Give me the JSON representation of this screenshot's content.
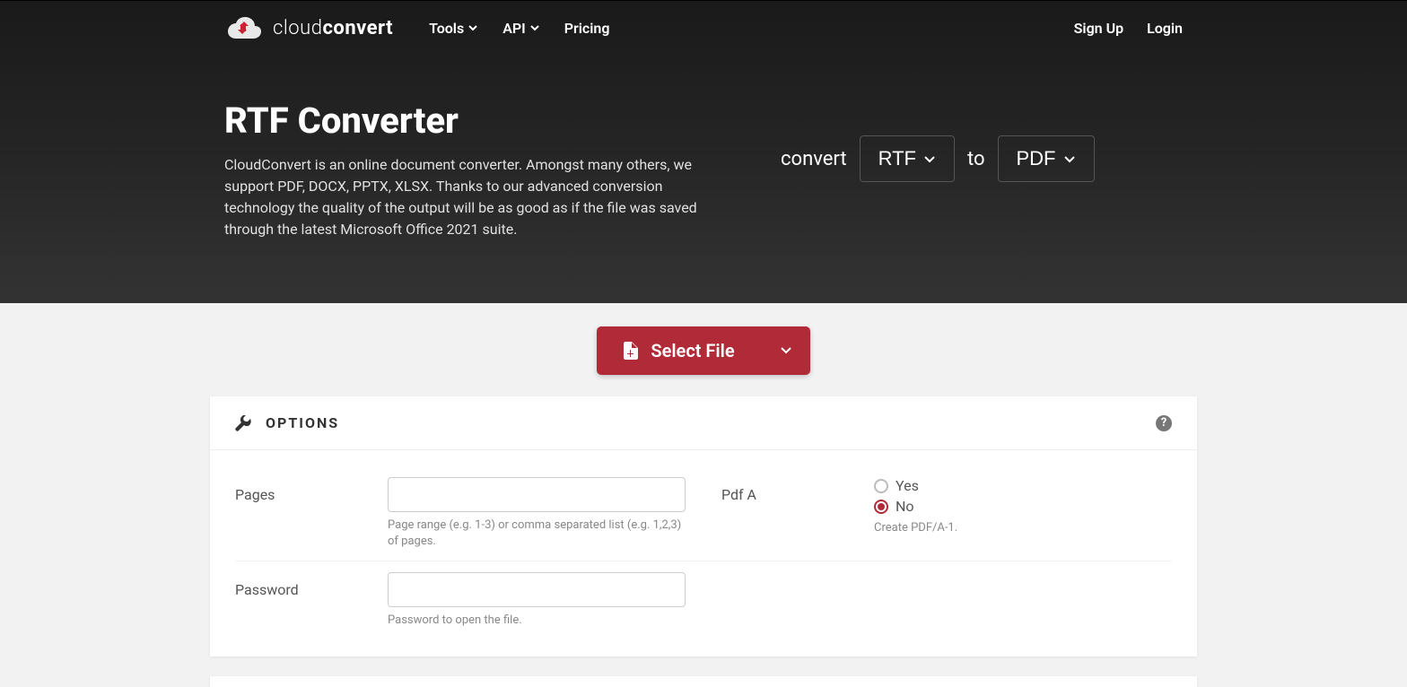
{
  "brand": {
    "part1": "cloud",
    "part2": "convert"
  },
  "nav": {
    "tools": "Tools",
    "api": "API",
    "pricing": "Pricing",
    "signup": "Sign Up",
    "login": "Login"
  },
  "hero": {
    "title": "RTF Converter",
    "description": "CloudConvert is an online document converter. Amongst many others, we support PDF, DOCX, PPTX, XLSX. Thanks to our advanced conversion technology the quality of the output will be as good as if the file was saved through the latest Microsoft Office 2021 suite."
  },
  "convert": {
    "label_convert": "convert",
    "from": "RTF",
    "label_to": "to",
    "to": "PDF"
  },
  "select_file": {
    "label": "Select File"
  },
  "options": {
    "title": "OPTIONS",
    "pages": {
      "label": "Pages",
      "help": "Page range (e.g. 1-3) or comma separated list (e.g. 1,2,3) of pages."
    },
    "password": {
      "label": "Password",
      "help": "Password to open the file."
    },
    "pdfa": {
      "label": "Pdf A",
      "yes": "Yes",
      "no": "No",
      "help": "Create PDF/A-1."
    }
  }
}
